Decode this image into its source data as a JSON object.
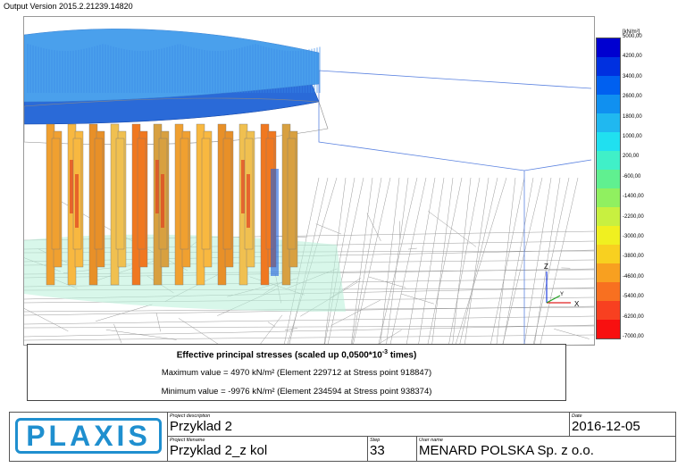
{
  "header": {
    "output_version": "Output Version 2015.2.21239.14820"
  },
  "viewport": {
    "axis_z": "Z",
    "axis_y": "Y",
    "axis_x": "X"
  },
  "legend": {
    "unit": "[kN/m²]",
    "ticks": [
      "5000,00",
      "4200,00",
      "3400,00",
      "2600,00",
      "1800,00",
      "1000,00",
      "200,00",
      "-600,00",
      "-1400,00",
      "-2200,00",
      "-3000,00",
      "-3800,00",
      "-4600,00",
      "-5400,00",
      "-6200,00",
      "-7000,00"
    ],
    "colors": [
      "#0000d0",
      "#0030e0",
      "#0060f0",
      "#1090f0",
      "#20b8f0",
      "#20e0f0",
      "#40f0c8",
      "#60f090",
      "#90f060",
      "#c8f040",
      "#f0f020",
      "#f8d020",
      "#f8a020",
      "#f87020",
      "#f84020",
      "#f81010"
    ]
  },
  "info": {
    "title": "Effective principal stresses (scaled up 0,0500*10",
    "title_exp": "-3",
    "title_end": " times)",
    "max_value": "Maximum value = 4970 kN/m² (Element 229712 at Stress point 918847)",
    "min_value": "Minimum value = -9976 kN/m² (Element 234594 at Stress point 938374)"
  },
  "footer": {
    "logo": "PLAXIS",
    "project_description_label": "Project description",
    "project_description": "Przyklad 2",
    "date_label": "Date",
    "date": "2016-12-05",
    "project_filename_label": "Project filename",
    "project_filename": "Przyklad 2_z kol",
    "step_label": "Step",
    "step": "33",
    "user_name_label": "User name",
    "user_name": "MENARD POLSKA Sp. z o.o."
  }
}
